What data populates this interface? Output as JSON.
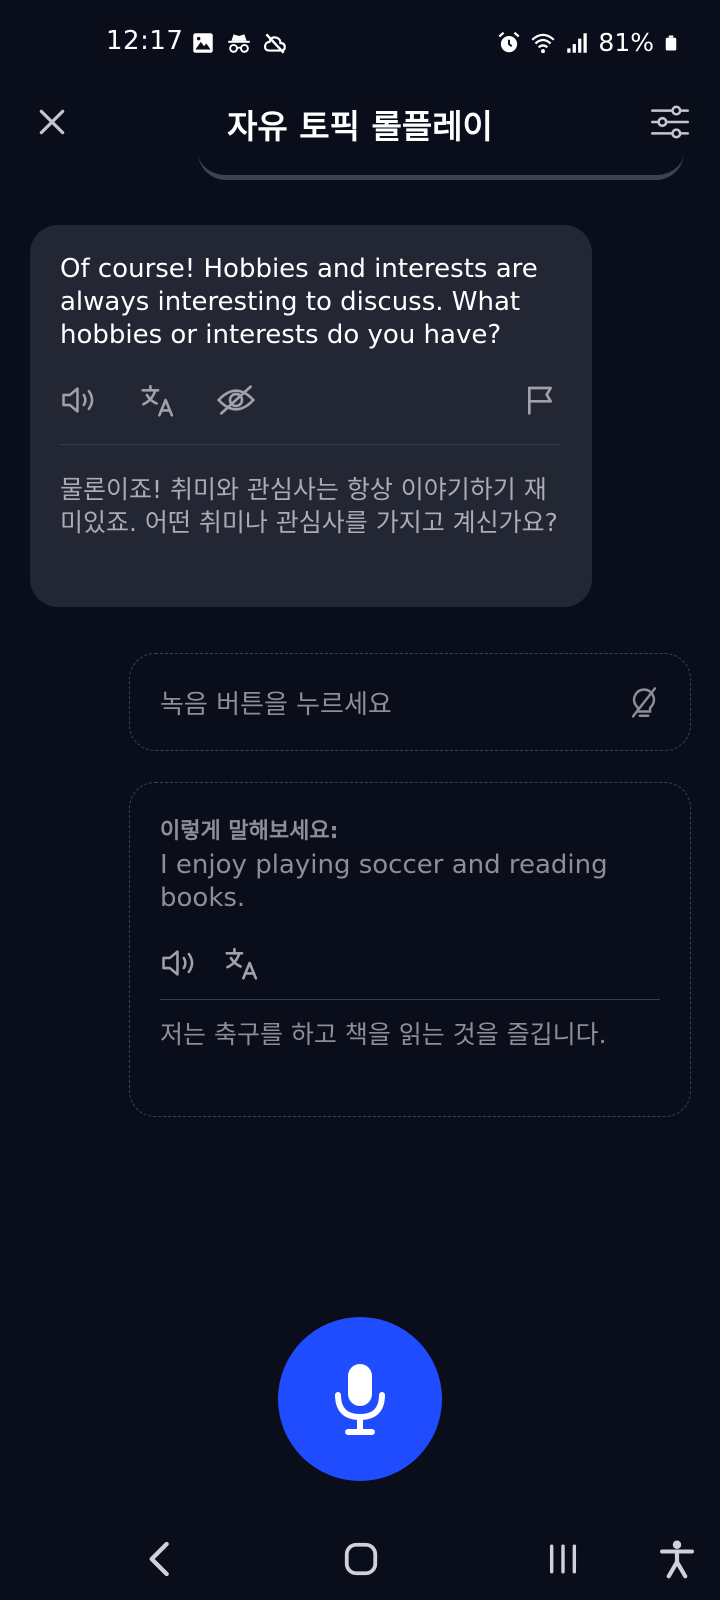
{
  "status_bar": {
    "time": "12:17",
    "battery": "81%",
    "left_icons": [
      "gallery-icon",
      "incognito-icon",
      "cloud-off-icon"
    ],
    "right_icons": [
      "alarm-icon",
      "wifi-icon",
      "signal-icon",
      "battery-icon"
    ]
  },
  "header": {
    "title": "자유 토픽 롤플레이",
    "close_icon": "close-icon",
    "settings_icon": "sliders-icon"
  },
  "ai_message": {
    "text": "Of course! Hobbies and interests are always interesting to discuss. What hobbies or interests do you have?",
    "translation": "물론이죠! 취미와 관심사는 항상 이야기하기 재미있죠. 어떤 취미나 관심사를 가지고 계신가요?",
    "actions": [
      "speaker-icon",
      "translate-icon",
      "hide-icon",
      "flag-icon"
    ]
  },
  "record_prompt": {
    "text": "녹음 버튼을 누르세요",
    "icon": "hint-off-icon"
  },
  "suggestion": {
    "label": "이렇게 말해보세요:",
    "text": "I enjoy playing soccer and reading books.",
    "translation": "저는 축구를 하고 책을 읽는 것을 즐깁니다.",
    "actions": [
      "speaker-icon",
      "translate-icon"
    ]
  },
  "mic": {
    "icon": "microphone-icon",
    "color": "#1f4cff"
  },
  "nav_bar": {
    "buttons": [
      "back-icon",
      "home-icon",
      "recents-icon",
      "accessibility-icon"
    ]
  },
  "colors": {
    "background": "#0a0d1a",
    "bubble": "#232633",
    "accent": "#1f4cff",
    "muted_text": "#8c8e99"
  }
}
